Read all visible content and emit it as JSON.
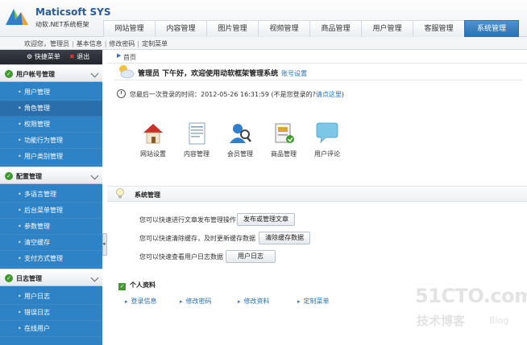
{
  "brand": {
    "name": "Maticsoft SYS",
    "subtitle": "动软.NET系统框架"
  },
  "nav": {
    "tabs": [
      "网站管理",
      "内容管理",
      "图片管理",
      "视频管理",
      "商品管理",
      "用户管理",
      "客服管理",
      "系统管理"
    ],
    "active": "系统管理"
  },
  "subbar": {
    "welcome": "欢迎您，管理员",
    "links": [
      "基本信息",
      "修改密码",
      "定制菜单"
    ]
  },
  "sidebar": {
    "quick_menu": "快捷菜单",
    "logout": "退出",
    "sections": [
      {
        "title": "用户帐号管理",
        "items": [
          "用户管理",
          "角色管理",
          "权限管理",
          "功能行为管理",
          "用户类别管理"
        ],
        "active": "角色管理"
      },
      {
        "title": "配置管理",
        "items": [
          "多语言管理",
          "后台菜单管理",
          "参数管理",
          "清空缓存",
          "支付方式管理"
        ]
      },
      {
        "title": "日志管理",
        "items": [
          "用户日志",
          "错误日志",
          "在线用户"
        ]
      }
    ]
  },
  "main": {
    "breadcrumb": "首页",
    "greeting": "管理员 下午好，欢迎使用动软框架管理系统",
    "account_settings": "账号设置",
    "last_login_text": "您最后一次登录的时间：2012-05-26 16:31:59 (不是您登录的?",
    "last_login_link": "请点这里",
    "last_login_close": ")",
    "shortcuts": [
      {
        "label": "网站设置",
        "icon": "house-icon"
      },
      {
        "label": "内容管理",
        "icon": "document-icon"
      },
      {
        "label": "会员管理",
        "icon": "users-icon"
      },
      {
        "label": "商品管理",
        "icon": "product-icon"
      },
      {
        "label": "用户评论",
        "icon": "comment-icon"
      }
    ],
    "system_title": "系统管理",
    "operations": [
      {
        "text": "您可以快速进行文章发布管理操作",
        "button": "发布或管理文章"
      },
      {
        "text": "您可以快速清除缓存，及时更新缓存数据",
        "button": "清除缓存数据"
      },
      {
        "text": "您可以快速查看用户日志数据",
        "button": "用户日志"
      }
    ],
    "profile_title": "个人资料",
    "profile_links": [
      "登录信息",
      "修改密码",
      "修改资料",
      "定制菜单"
    ]
  },
  "watermark": {
    "line1": "51CTO.com",
    "line2": "技术博客",
    "line3": "Blog"
  },
  "colors": {
    "accent": "#2e82c6",
    "active_tab": "#2a6fb0",
    "link": "#2a6fb0",
    "ok_green": "#3d9a2b"
  }
}
